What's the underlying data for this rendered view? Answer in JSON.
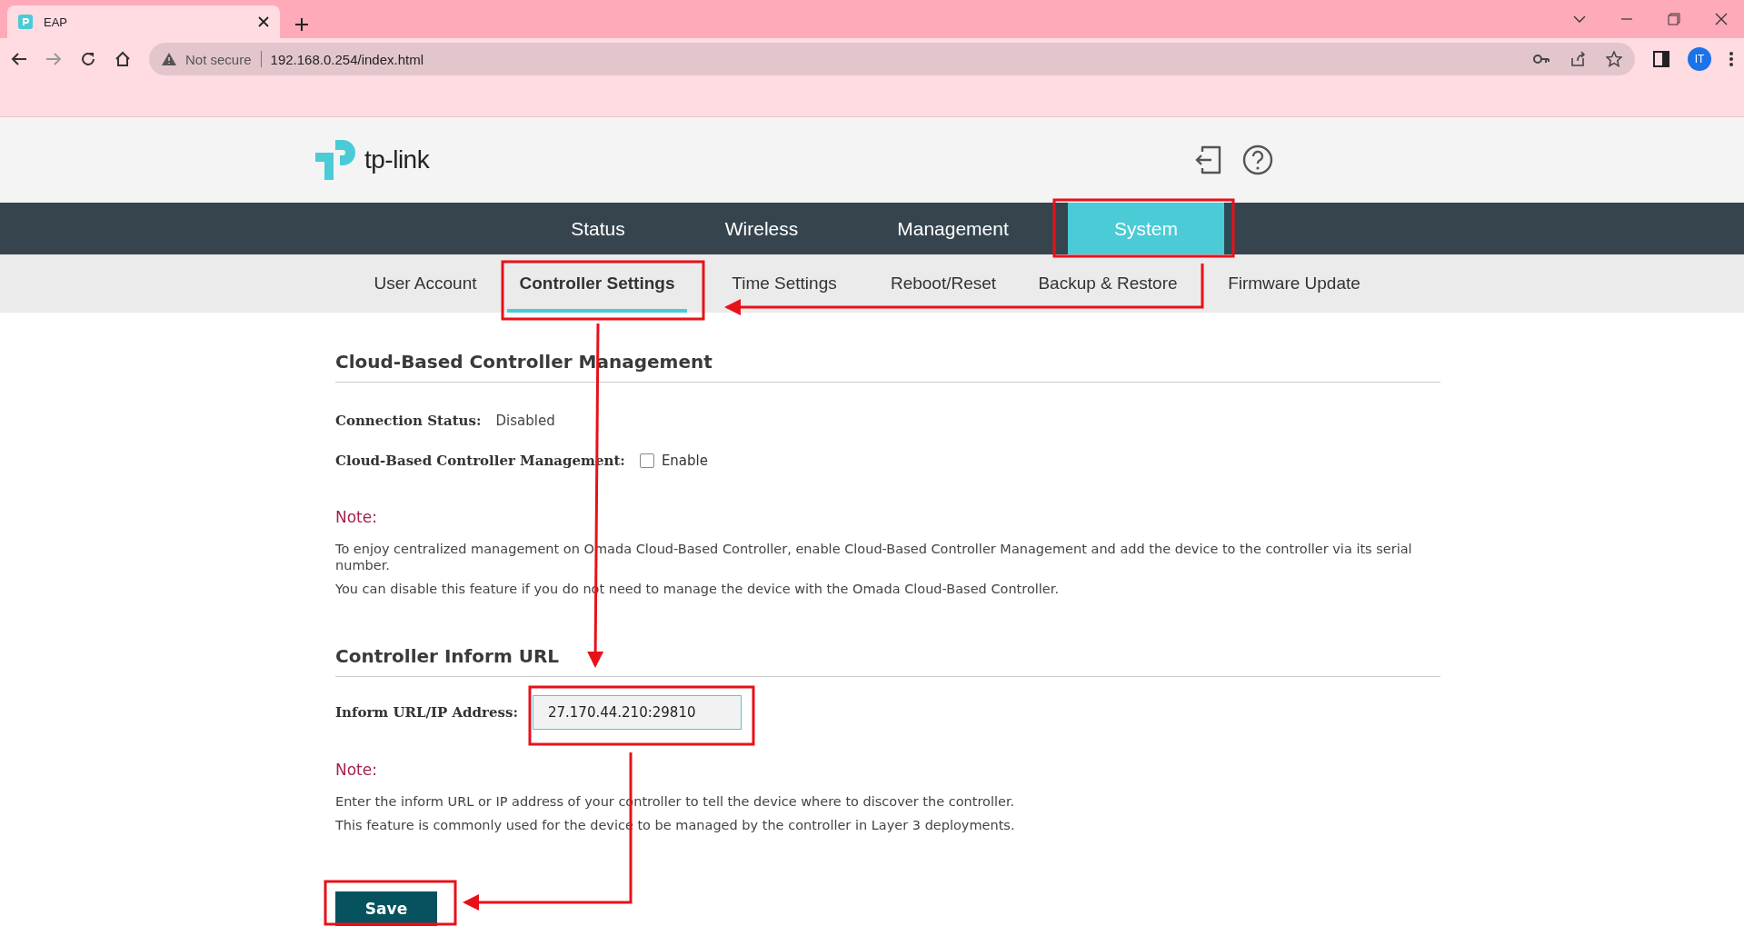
{
  "browser": {
    "tab_title": "EAP",
    "address": {
      "security": "Not secure",
      "url": "192.168.0.254/index.html"
    },
    "profile": "IT"
  },
  "header": {
    "logo_text": "tp-link"
  },
  "main_nav": [
    {
      "label": "Status",
      "selected": false
    },
    {
      "label": "Wireless",
      "selected": false
    },
    {
      "label": "Management",
      "selected": false
    },
    {
      "label": "System",
      "selected": true
    }
  ],
  "sub_nav": [
    {
      "label": "User Account",
      "selected": false
    },
    {
      "label": "Controller Settings",
      "selected": true
    },
    {
      "label": "Time Settings",
      "selected": false
    },
    {
      "label": "Reboot/Reset",
      "selected": false
    },
    {
      "label": "Backup & Restore",
      "selected": false
    },
    {
      "label": "Firmware Update",
      "selected": false
    }
  ],
  "sections": [
    {
      "heading": "Cloud-Based Controller Management",
      "rows": [
        {
          "kind": "text",
          "label": "Connection Status:",
          "value": "Disabled"
        },
        {
          "kind": "checkbox",
          "label": "Cloud-Based Controller Management:",
          "option": "Enable",
          "checked": false
        }
      ],
      "note": {
        "title": "Note:",
        "paragraphs": [
          "To enjoy centralized management on Omada Cloud-Based Controller, enable Cloud-Based Controller Management and add the device to the controller via its serial number.",
          "You can disable this feature if you do not need to manage the device with the Omada Cloud-Based Controller."
        ]
      }
    },
    {
      "heading": "Controller Inform URL",
      "rows": [
        {
          "kind": "input",
          "label": "Inform URL/IP Address:",
          "value": "27.170.44.210:29810"
        }
      ],
      "note": {
        "title": "Note:",
        "paragraphs": [
          "Enter the inform URL or IP address of your controller to tell the device where to discover the controller.",
          "This feature is commonly used for the device to be managed by the controller in Layer 3 deployments."
        ]
      }
    }
  ],
  "save_button": "Save"
}
